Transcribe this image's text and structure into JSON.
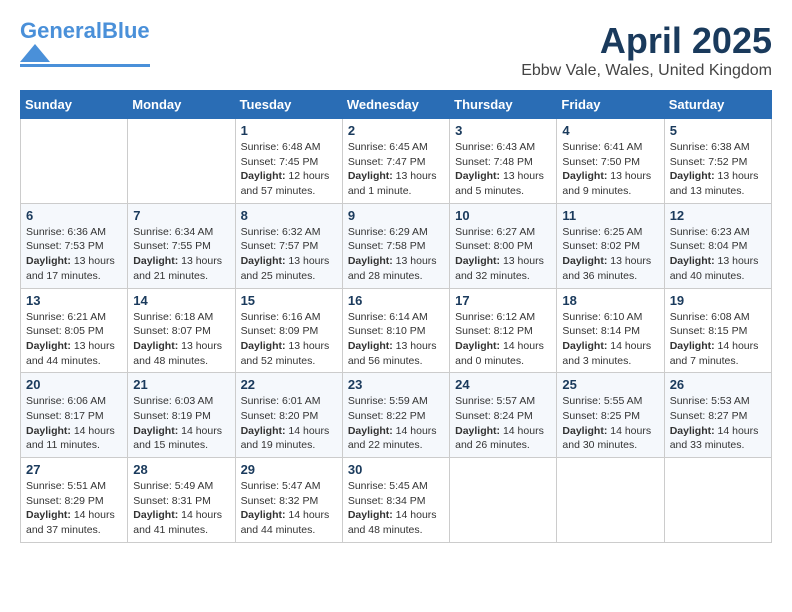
{
  "header": {
    "logo_general": "General",
    "logo_blue": "Blue",
    "title": "April 2025",
    "subtitle": "Ebbw Vale, Wales, United Kingdom"
  },
  "weekdays": [
    "Sunday",
    "Monday",
    "Tuesday",
    "Wednesday",
    "Thursday",
    "Friday",
    "Saturday"
  ],
  "weeks": [
    [
      {
        "day": "",
        "info": ""
      },
      {
        "day": "",
        "info": ""
      },
      {
        "day": "1",
        "info": "Sunrise: 6:48 AM\nSunset: 7:45 PM\nDaylight: 12 hours and 57 minutes."
      },
      {
        "day": "2",
        "info": "Sunrise: 6:45 AM\nSunset: 7:47 PM\nDaylight: 13 hours and 1 minute."
      },
      {
        "day": "3",
        "info": "Sunrise: 6:43 AM\nSunset: 7:48 PM\nDaylight: 13 hours and 5 minutes."
      },
      {
        "day": "4",
        "info": "Sunrise: 6:41 AM\nSunset: 7:50 PM\nDaylight: 13 hours and 9 minutes."
      },
      {
        "day": "5",
        "info": "Sunrise: 6:38 AM\nSunset: 7:52 PM\nDaylight: 13 hours and 13 minutes."
      }
    ],
    [
      {
        "day": "6",
        "info": "Sunrise: 6:36 AM\nSunset: 7:53 PM\nDaylight: 13 hours and 17 minutes."
      },
      {
        "day": "7",
        "info": "Sunrise: 6:34 AM\nSunset: 7:55 PM\nDaylight: 13 hours and 21 minutes."
      },
      {
        "day": "8",
        "info": "Sunrise: 6:32 AM\nSunset: 7:57 PM\nDaylight: 13 hours and 25 minutes."
      },
      {
        "day": "9",
        "info": "Sunrise: 6:29 AM\nSunset: 7:58 PM\nDaylight: 13 hours and 28 minutes."
      },
      {
        "day": "10",
        "info": "Sunrise: 6:27 AM\nSunset: 8:00 PM\nDaylight: 13 hours and 32 minutes."
      },
      {
        "day": "11",
        "info": "Sunrise: 6:25 AM\nSunset: 8:02 PM\nDaylight: 13 hours and 36 minutes."
      },
      {
        "day": "12",
        "info": "Sunrise: 6:23 AM\nSunset: 8:04 PM\nDaylight: 13 hours and 40 minutes."
      }
    ],
    [
      {
        "day": "13",
        "info": "Sunrise: 6:21 AM\nSunset: 8:05 PM\nDaylight: 13 hours and 44 minutes."
      },
      {
        "day": "14",
        "info": "Sunrise: 6:18 AM\nSunset: 8:07 PM\nDaylight: 13 hours and 48 minutes."
      },
      {
        "day": "15",
        "info": "Sunrise: 6:16 AM\nSunset: 8:09 PM\nDaylight: 13 hours and 52 minutes."
      },
      {
        "day": "16",
        "info": "Sunrise: 6:14 AM\nSunset: 8:10 PM\nDaylight: 13 hours and 56 minutes."
      },
      {
        "day": "17",
        "info": "Sunrise: 6:12 AM\nSunset: 8:12 PM\nDaylight: 14 hours and 0 minutes."
      },
      {
        "day": "18",
        "info": "Sunrise: 6:10 AM\nSunset: 8:14 PM\nDaylight: 14 hours and 3 minutes."
      },
      {
        "day": "19",
        "info": "Sunrise: 6:08 AM\nSunset: 8:15 PM\nDaylight: 14 hours and 7 minutes."
      }
    ],
    [
      {
        "day": "20",
        "info": "Sunrise: 6:06 AM\nSunset: 8:17 PM\nDaylight: 14 hours and 11 minutes."
      },
      {
        "day": "21",
        "info": "Sunrise: 6:03 AM\nSunset: 8:19 PM\nDaylight: 14 hours and 15 minutes."
      },
      {
        "day": "22",
        "info": "Sunrise: 6:01 AM\nSunset: 8:20 PM\nDaylight: 14 hours and 19 minutes."
      },
      {
        "day": "23",
        "info": "Sunrise: 5:59 AM\nSunset: 8:22 PM\nDaylight: 14 hours and 22 minutes."
      },
      {
        "day": "24",
        "info": "Sunrise: 5:57 AM\nSunset: 8:24 PM\nDaylight: 14 hours and 26 minutes."
      },
      {
        "day": "25",
        "info": "Sunrise: 5:55 AM\nSunset: 8:25 PM\nDaylight: 14 hours and 30 minutes."
      },
      {
        "day": "26",
        "info": "Sunrise: 5:53 AM\nSunset: 8:27 PM\nDaylight: 14 hours and 33 minutes."
      }
    ],
    [
      {
        "day": "27",
        "info": "Sunrise: 5:51 AM\nSunset: 8:29 PM\nDaylight: 14 hours and 37 minutes."
      },
      {
        "day": "28",
        "info": "Sunrise: 5:49 AM\nSunset: 8:31 PM\nDaylight: 14 hours and 41 minutes."
      },
      {
        "day": "29",
        "info": "Sunrise: 5:47 AM\nSunset: 8:32 PM\nDaylight: 14 hours and 44 minutes."
      },
      {
        "day": "30",
        "info": "Sunrise: 5:45 AM\nSunset: 8:34 PM\nDaylight: 14 hours and 48 minutes."
      },
      {
        "day": "",
        "info": ""
      },
      {
        "day": "",
        "info": ""
      },
      {
        "day": "",
        "info": ""
      }
    ]
  ]
}
